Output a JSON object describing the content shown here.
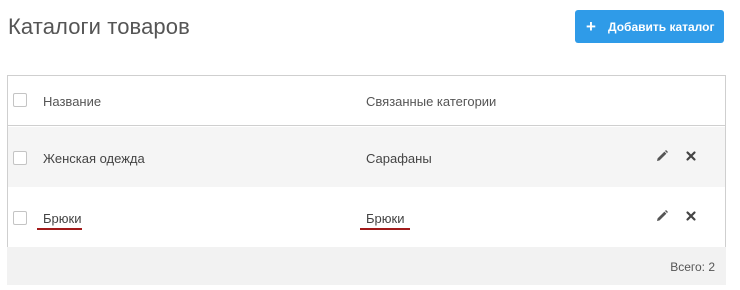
{
  "header": {
    "title": "Каталоги товаров",
    "add_button_label": "Добавить каталог",
    "add_icon": "plus-icon"
  },
  "table": {
    "columns": [
      "Название",
      "Связанные категории"
    ],
    "rows": [
      {
        "name": "Женская одежда",
        "categories": "Сарафаны",
        "checked": false
      },
      {
        "name": "Брюки",
        "categories": "Брюки",
        "checked": false
      }
    ],
    "row_actions": [
      "pencil-icon",
      "close-icon"
    ]
  },
  "footer": {
    "total": "Всего: 2"
  },
  "colors": {
    "accent": "#2f9be8",
    "underline": "#a11a1a"
  }
}
